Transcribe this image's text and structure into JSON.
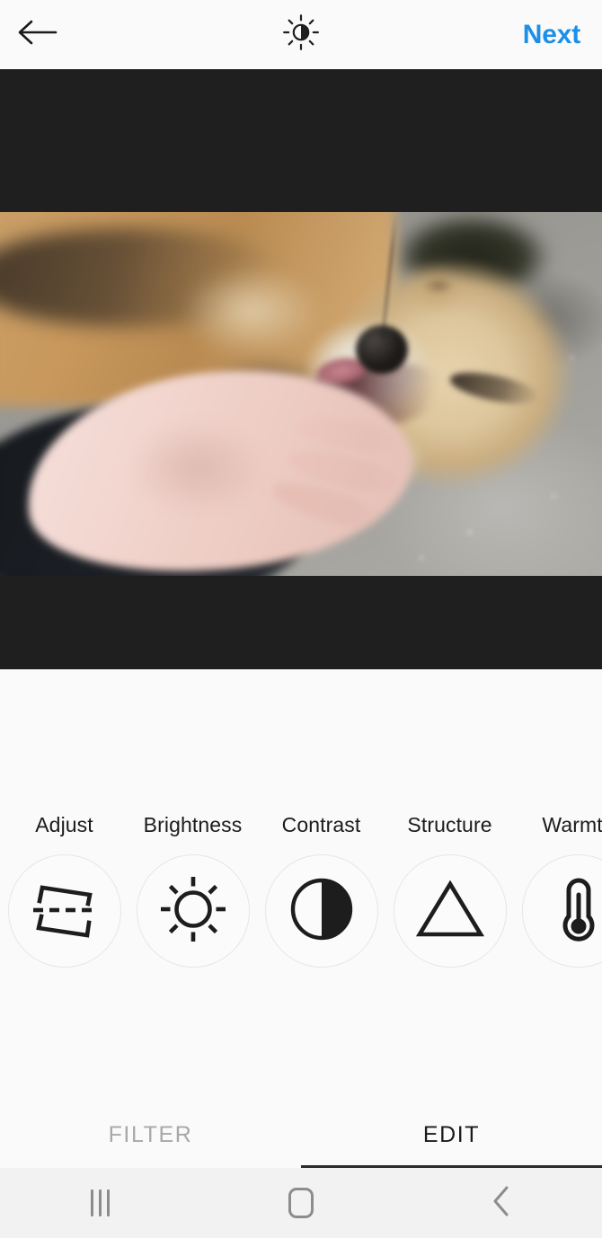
{
  "header": {
    "back_icon": "arrow-left-icon",
    "lux_icon": "brightness-sun-icon",
    "next_label": "Next",
    "accent_color": "#1c8fe8"
  },
  "photo": {
    "alt": "Close-up of a fox lying on gravel being petted by a pale hand in a dark sleeve",
    "letterbox_color": "#1f1f1f",
    "background_color": "#fafafa"
  },
  "tools": {
    "items": [
      {
        "label": "Adjust",
        "icon": "adjust-rotate-icon"
      },
      {
        "label": "Brightness",
        "icon": "sun-icon"
      },
      {
        "label": "Contrast",
        "icon": "contrast-half-circle-icon"
      },
      {
        "label": "Structure",
        "icon": "triangle-icon"
      },
      {
        "label": "Warmth",
        "icon": "thermometer-icon"
      }
    ]
  },
  "tabs": {
    "filter_label": "FILTER",
    "edit_label": "EDIT",
    "active": "EDIT"
  },
  "navbar": {
    "recents_icon": "recents-icon",
    "home_icon": "home-icon",
    "back_icon": "back-chevron-icon"
  }
}
